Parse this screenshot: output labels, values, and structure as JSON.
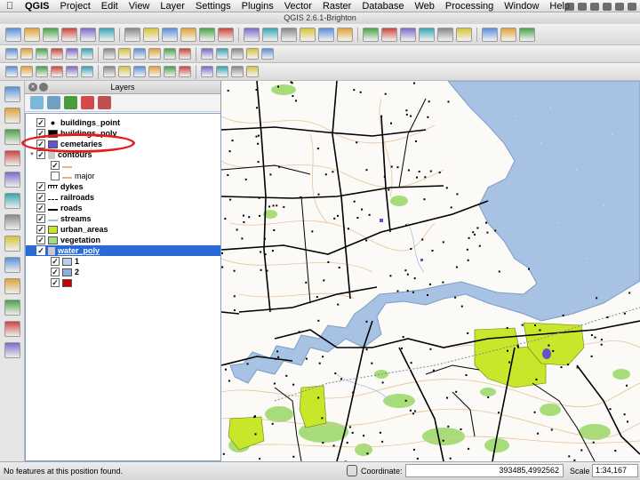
{
  "menubar": {
    "app": "QGIS",
    "items": [
      "Project",
      "Edit",
      "View",
      "Layer",
      "Settings",
      "Plugins",
      "Vector",
      "Raster",
      "Database",
      "Web",
      "Processing",
      "Window",
      "Help"
    ]
  },
  "window": {
    "title": "QGIS 2.6.1-Brighton"
  },
  "toolbar_icons": {
    "row1": [
      "new-project",
      "open-project",
      "save-project",
      "save-as",
      "print-composer",
      "composer-manager",
      "pan",
      "pan-to-selection",
      "zoom-in",
      "zoom-out",
      "zoom-full",
      "zoom-to-selection",
      "zoom-to-layer",
      "zoom-native",
      "zoom-last",
      "zoom-next",
      "refresh",
      "identify",
      "select",
      "deselect",
      "field-calculator",
      "attribute-table",
      "measure",
      "map-tips",
      "new-bookmark",
      "show-bookmarks",
      "text-annotation"
    ],
    "row2": [
      "current-edits",
      "toggle-editing",
      "save-edits",
      "add-feature",
      "move-feature",
      "node-tool",
      "delete-selected",
      "cut-features",
      "copy-features",
      "paste-features",
      "label-tool",
      "pin-labels",
      "show-hide-labels",
      "move-label",
      "rotate-label",
      "change-label",
      "csw"
    ],
    "row3": [
      "undo",
      "redo",
      "simplify",
      "add-ring",
      "add-part",
      "fill-ring",
      "delete-ring",
      "delete-part",
      "reshape",
      "offset-curve",
      "split-features",
      "split-parts",
      "merge-selected",
      "merge-attributes",
      "rotate-symbols",
      "gps"
    ]
  },
  "left_toolbar": [
    "add-vector-layer",
    "add-raster-layer",
    "add-postgis-layer",
    "add-spatialite-layer",
    "add-mssql-layer",
    "add-oracle-layer",
    "add-wms-layer",
    "add-wcs-layer",
    "add-wfs-layer",
    "add-delimited-text-layer",
    "new-shapefile",
    "new-spatialite",
    "add-virtual-layer"
  ],
  "layers_panel": {
    "title": "Layers",
    "tools": [
      "add-group",
      "manage-visibility",
      "filter-legend",
      "expand-all",
      "collapse-all"
    ],
    "items": [
      {
        "label": "buildings_point",
        "checked": true,
        "symbol": "point",
        "color": "#000000"
      },
      {
        "label": "buildings_poly",
        "checked": true,
        "symbol": "fill",
        "color": "#000000"
      },
      {
        "label": "cemetaries",
        "checked": true,
        "symbol": "fill",
        "color": "#6a4fc9",
        "highlighted": true
      },
      {
        "label": "contours",
        "checked": true,
        "symbol": "group"
      },
      {
        "label": "",
        "checked": true,
        "symbol": "line",
        "color": "#e4b38c"
      },
      {
        "label": "major",
        "checked": false,
        "symbol": "line",
        "color": "#e4b38c"
      },
      {
        "label": "dykes",
        "checked": true,
        "symbol": "dyke"
      },
      {
        "label": "railroads",
        "checked": true,
        "symbol": "rail"
      },
      {
        "label": "roads",
        "checked": true,
        "symbol": "road",
        "color": "#000000"
      },
      {
        "label": "streams",
        "checked": true,
        "symbol": "line",
        "color": "#9fc4e8"
      },
      {
        "label": "urban_areas",
        "checked": true,
        "symbol": "fill",
        "color": "#c8e62a"
      },
      {
        "label": "vegetation",
        "checked": true,
        "symbol": "fill",
        "color": "#a6dc7a"
      },
      {
        "label": "water_poly",
        "checked": true,
        "symbol": "group",
        "selected": true
      },
      {
        "label": "1",
        "checked": true,
        "symbol": "fill",
        "color": "#b9cfea"
      },
      {
        "label": "2",
        "checked": true,
        "symbol": "fill",
        "color": "#8fb0da"
      },
      {
        "label": "",
        "checked": true,
        "symbol": "fill",
        "color": "#c80000"
      }
    ]
  },
  "status": {
    "message": "No features at this position found.",
    "coordinate_label": "Coordinate:",
    "coordinate": "393485,4992562",
    "scale_label": "Scale",
    "scale": "1:34,167"
  },
  "colors": {
    "water": "#a7c2e3",
    "urban": "#c8e62a",
    "vegetation": "#a6dc7a",
    "contour": "#e8c29a",
    "road": "#000000",
    "selection": "#2a6ad8",
    "annotation": "#e51d1d"
  }
}
